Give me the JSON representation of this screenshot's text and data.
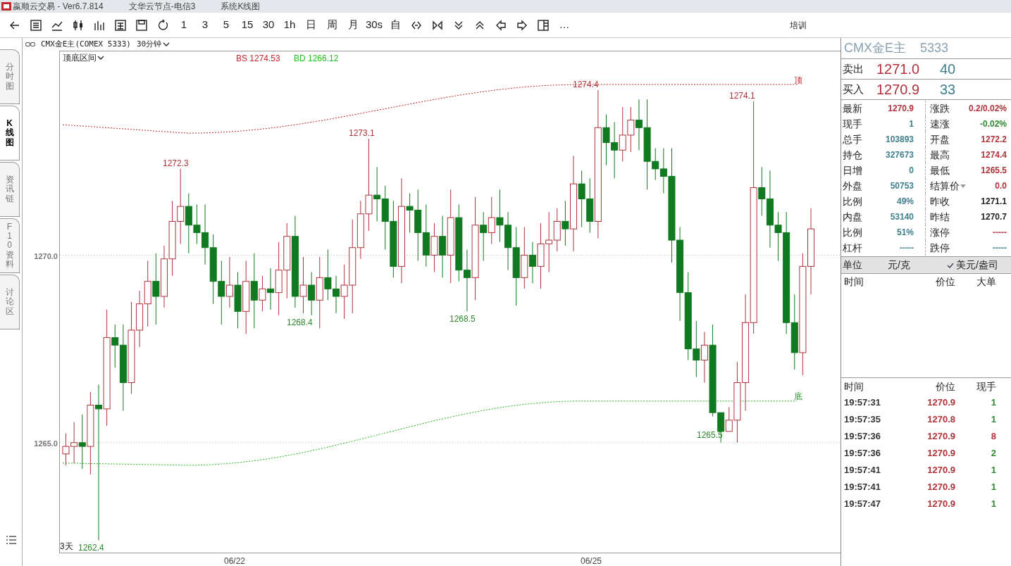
{
  "title_bar": {
    "app": "嬴顺云交易 - Ver6.7.814",
    "node": "文华云节点-电信3",
    "view": "系统K线图"
  },
  "toolbar": {
    "periods": [
      "1",
      "3",
      "5",
      "15",
      "30",
      "1h",
      "日",
      "周",
      "月",
      "30s",
      "自"
    ],
    "more": "…",
    "right_label": "培训"
  },
  "chart_header": {
    "symbol": "CMX金E主(COMEX 5333)",
    "period": "30分钟"
  },
  "side_tabs": [
    {
      "label": "分时图",
      "selected": false
    },
    {
      "label": "K线图",
      "selected": true
    },
    {
      "label": "资讯链",
      "selected": false
    },
    {
      "label": "F10资料",
      "selected": false
    },
    {
      "label": "讨论区",
      "selected": false
    }
  ],
  "chart": {
    "indicator": "顶底区间",
    "bs": "BS 1274.53",
    "bd": "BD 1266.12",
    "top_label": "顶",
    "bottom_label": "底",
    "range_label": "3天",
    "y_ticks": [
      "1270.0",
      "1265.0"
    ],
    "x_ticks": [
      "06/22",
      "06/25"
    ],
    "price_labels": [
      {
        "text": "1272.3",
        "kind": "high"
      },
      {
        "text": "1273.1",
        "kind": "high"
      },
      {
        "text": "1274.4",
        "kind": "high"
      },
      {
        "text": "1274.1",
        "kind": "high"
      },
      {
        "text": "1268.4",
        "kind": "low"
      },
      {
        "text": "1268.5",
        "kind": "low"
      },
      {
        "text": "1265.5",
        "kind": "low"
      },
      {
        "text": "1262.4",
        "kind": "low"
      }
    ]
  },
  "quote": {
    "name": "CMX金E主",
    "code": "5333",
    "ask": {
      "label": "卖出",
      "price": "1271.0",
      "volume": "40"
    },
    "bid": {
      "label": "买入",
      "price": "1270.9",
      "volume": "33"
    },
    "stats": [
      {
        "left": {
          "label": "最新",
          "value": "1270.9",
          "color": "#b0323a"
        },
        "right": {
          "label": "涨跌",
          "value": "0.2/0.02%",
          "color": "#b0323a"
        }
      },
      {
        "left": {
          "label": "现手",
          "value": "1",
          "color": "#3f7f8c"
        },
        "right": {
          "label": "速涨",
          "value": "-0.02%",
          "color": "#2e8a2e"
        }
      },
      {
        "left": {
          "label": "总手",
          "value": "103893",
          "color": "#3f7f8c"
        },
        "right": {
          "label": "开盘",
          "value": "1272.2",
          "color": "#b0323a"
        }
      },
      {
        "left": {
          "label": "持仓",
          "value": "327673",
          "color": "#3f7f8c"
        },
        "right": {
          "label": "最高",
          "value": "1274.4",
          "color": "#b0323a"
        }
      },
      {
        "left": {
          "label": "日增",
          "value": "0",
          "color": "#3f7f8c"
        },
        "right": {
          "label": "最低",
          "value": "1265.5",
          "color": "#b0323a"
        }
      },
      {
        "left": {
          "label": "外盘",
          "value": "50753",
          "color": "#3f7f8c"
        },
        "right": {
          "label": "结算价",
          "value": "0.0",
          "color": "#b0323a",
          "caret": true
        }
      },
      {
        "left": {
          "label": "比例",
          "value": "49%",
          "color": "#3f7f8c"
        },
        "right": {
          "label": "昨收",
          "value": "1271.1",
          "color": "#222222"
        }
      },
      {
        "left": {
          "label": "内盘",
          "value": "53140",
          "color": "#3f7f8c"
        },
        "right": {
          "label": "昨结",
          "value": "1270.7",
          "color": "#222222"
        }
      },
      {
        "left": {
          "label": "比例",
          "value": "51%",
          "color": "#3f7f8c"
        },
        "right": {
          "label": "涨停",
          "value": "-----",
          "color": "#b0323a"
        }
      },
      {
        "left": {
          "label": "杠杆",
          "value": "-----",
          "color": "#3f7f8c"
        },
        "right": {
          "label": "跌停",
          "value": "-----",
          "color": "#3f7f8c"
        }
      }
    ]
  },
  "unit_bar": {
    "label": "单位",
    "option": "元/克",
    "checked_option": {
      "label": "美元/盎司",
      "checked": true
    }
  },
  "big_orders": {
    "columns": [
      "时间",
      "价位",
      "大单"
    ]
  },
  "trades": {
    "columns": [
      "时间",
      "价位",
      "现手"
    ],
    "rows": [
      {
        "time": "19:57:31",
        "price": "1270.9",
        "volume": "1",
        "color": "#2e8a2e"
      },
      {
        "time": "19:57:35",
        "price": "1270.8",
        "volume": "1",
        "color": "#2e8a2e"
      },
      {
        "time": "19:57:36",
        "price": "1270.9",
        "volume": "8",
        "color": "#b0323a"
      },
      {
        "time": "19:57:36",
        "price": "1270.9",
        "volume": "2",
        "color": "#2e8a2e"
      },
      {
        "time": "19:57:41",
        "price": "1270.9",
        "volume": "1",
        "color": "#2e8a2e"
      },
      {
        "time": "19:57:41",
        "price": "1270.9",
        "volume": "1",
        "color": "#2e8a2e"
      },
      {
        "time": "19:57:47",
        "price": "1270.9",
        "volume": "1",
        "color": "#2e8a2e"
      }
    ]
  }
}
